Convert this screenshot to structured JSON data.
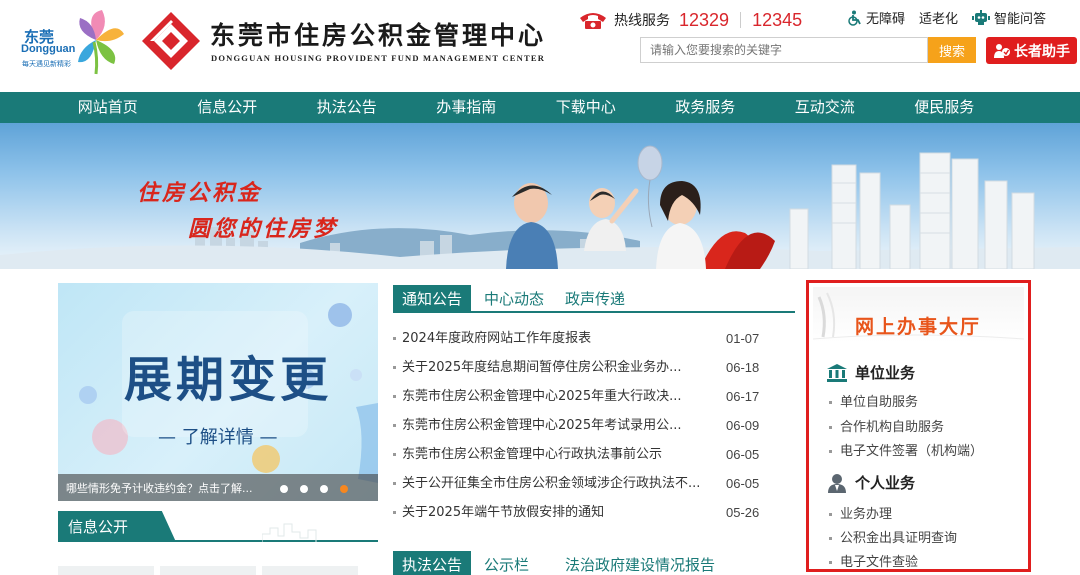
{
  "header": {
    "city_logo_cn": "东莞",
    "city_logo_en": "Dongguan",
    "city_logo_slogan": "每天遇见新精彩",
    "title_cn": "东莞市住房公积金管理中心",
    "title_en": "DONGGUAN HOUSING PROVIDENT FUND MANAGEMENT CENTER",
    "hotline_label": "热线服务",
    "hotline_numbers": [
      "12329",
      "12345"
    ],
    "tools": {
      "accessibility": "无障碍",
      "elderly": "适老化",
      "qa": "智能问答"
    },
    "search_placeholder": "请输入您要搜索的关键字",
    "search_button": "搜索",
    "elder_assistant": "长者助手"
  },
  "nav": [
    "网站首页",
    "信息公开",
    "执法公告",
    "办事指南",
    "下载中心",
    "政务服务",
    "互动交流",
    "便民服务"
  ],
  "banner": {
    "slogan_line1": "住房公积金",
    "slogan_line2": "圆您的住房梦"
  },
  "carousel": {
    "title": "展期变更",
    "link": "— 了解详情 —",
    "caption": "哪些情形免予计收违约金？点击了解...",
    "active_index": 3,
    "count": 4
  },
  "info_section": {
    "title": "信息公开"
  },
  "news": {
    "tabs": [
      "通知公告",
      "中心动态",
      "政声传递"
    ],
    "items": [
      {
        "title": "2024年度政府网站工作年度报表",
        "date": "01-07"
      },
      {
        "title": "关于2025年度结息期间暂停住房公积金业务办...",
        "date": "06-18"
      },
      {
        "title": "东莞市住房公积金管理中心2025年重大行政决...",
        "date": "06-17"
      },
      {
        "title": "东莞市住房公积金管理中心2025年考试录用公...",
        "date": "06-09"
      },
      {
        "title": "东莞市住房公积金管理中心行政执法事前公示",
        "date": "06-05"
      },
      {
        "title": "关于公开征集全市住房公积金领域涉企行政执法不...",
        "date": "06-05"
      },
      {
        "title": "关于2025年端午节放假安排的通知",
        "date": "05-26"
      }
    ]
  },
  "bottom_tabs": [
    "执法公告",
    "公示栏",
    "法治政府建设情况报告"
  ],
  "online_hall": {
    "title": "网上办事大厅",
    "unit_title": "单位业务",
    "unit_links": [
      "单位自助服务",
      "合作机构自助服务",
      "电子文件签署（机构端）"
    ],
    "personal_title": "个人业务",
    "personal_links": [
      "业务办理",
      "公积金出具证明查询",
      "电子文件查验"
    ]
  },
  "colors": {
    "nav": "#1a7a78",
    "accent_red": "#e01e1e",
    "search_orange": "#f6a21a",
    "hotline_red": "#d9262c"
  }
}
